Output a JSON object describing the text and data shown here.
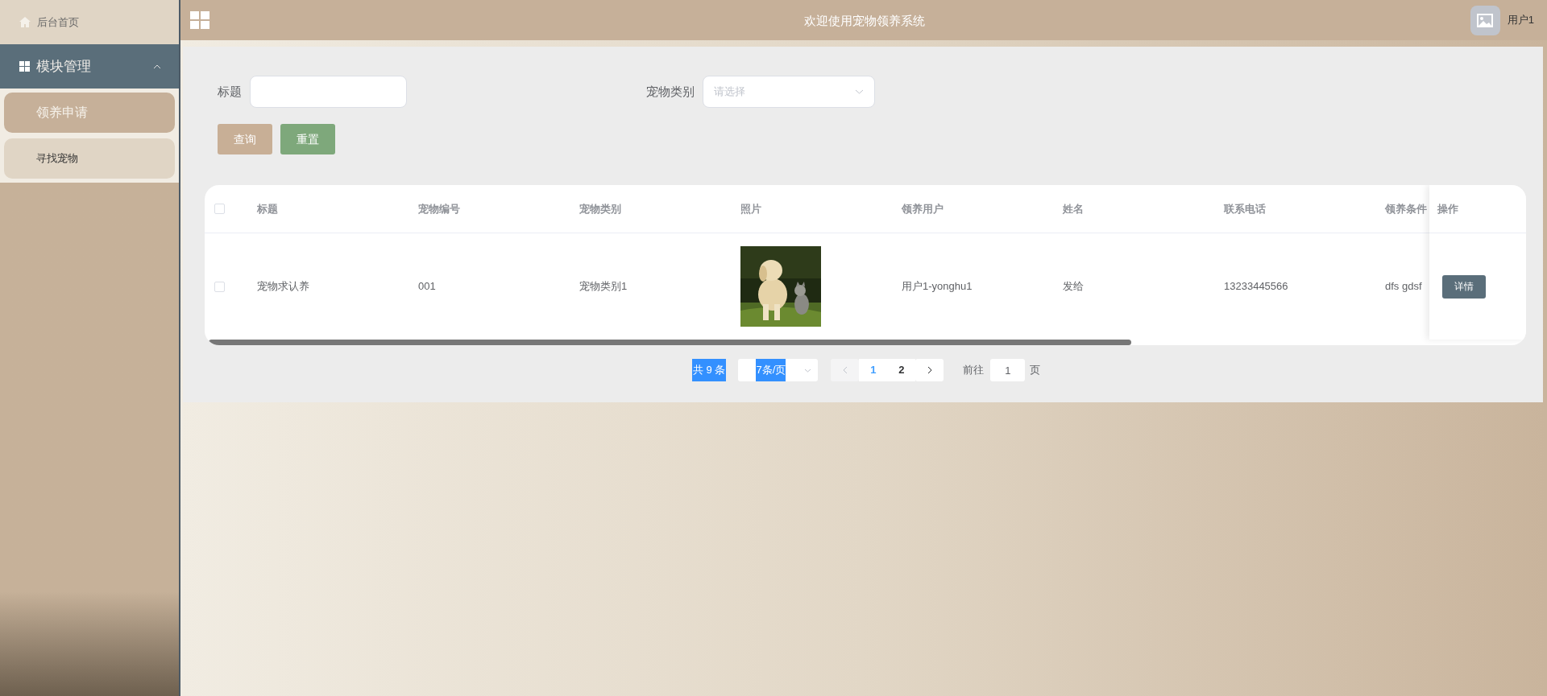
{
  "sidebar": {
    "home": {
      "label": "后台首页"
    },
    "groups": [
      {
        "label": "模块管理",
        "expanded": true,
        "items": [
          {
            "label": "领养申请",
            "selected": true
          },
          {
            "label": "寻找宠物",
            "selected": false
          }
        ]
      }
    ]
  },
  "header": {
    "title": "欢迎使用宠物领养系统",
    "user": "用户1"
  },
  "search": {
    "fields": [
      {
        "kind": "text",
        "label": "标题"
      },
      {
        "kind": "select",
        "label": "宠物类别",
        "placeholder": "请选择"
      }
    ],
    "buttons": [
      {
        "kind": "query",
        "label": "查询"
      },
      {
        "kind": "reset",
        "label": "重置"
      }
    ]
  },
  "table": {
    "header_checked": false,
    "columns": [
      "标题",
      "宠物编号",
      "宠物类别",
      "照片",
      "领养用户",
      "姓名",
      "联系电话",
      "领养条件"
    ],
    "action_column": "操作",
    "rows": [
      {
        "checked": false,
        "cells": [
          {
            "kind": "text",
            "text": "宠物求认养"
          },
          {
            "kind": "text",
            "text": "001"
          },
          {
            "kind": "text",
            "text": "宠物类别1"
          },
          {
            "kind": "picture"
          },
          {
            "kind": "text",
            "text": "用户1-yonghu1"
          },
          {
            "kind": "text",
            "text": "发给"
          },
          {
            "kind": "text",
            "text": "13233445566"
          },
          {
            "kind": "text",
            "text": "dfs gdsf"
          }
        ],
        "action": "详情"
      }
    ]
  },
  "pagination": {
    "total": "共 9 条",
    "page_size": "7条/页",
    "prev_disabled": true,
    "pages": [
      {
        "label": "1",
        "selected": true
      },
      {
        "label": "2",
        "selected": false
      }
    ],
    "goto_label": "前往",
    "goto_value": "1",
    "goto_suffix": "页"
  }
}
